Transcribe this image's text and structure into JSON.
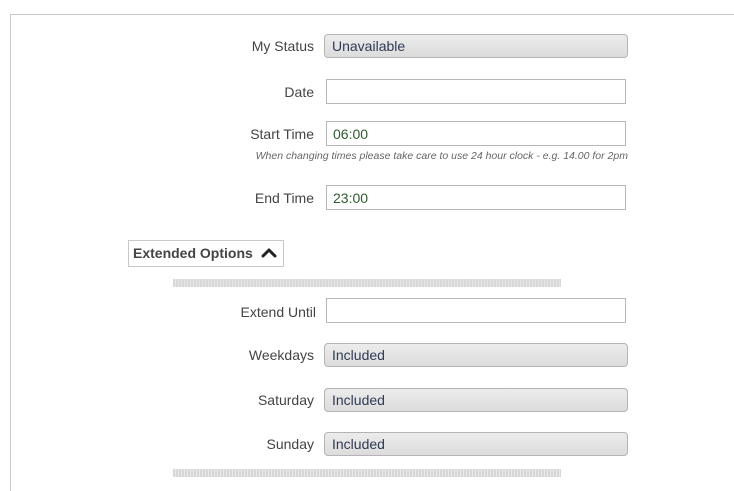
{
  "form": {
    "my_status": {
      "label": "My Status",
      "value": "Unavailable"
    },
    "date": {
      "label": "Date",
      "value": ""
    },
    "start_time": {
      "label": "Start Time",
      "value": "06:00"
    },
    "time_hint": "When changing times please take care to use 24 hour clock - e.g. 14.00 for 2pm",
    "end_time": {
      "label": "End Time",
      "value": "23:00"
    }
  },
  "extended": {
    "toggle_label": "Extended Options",
    "extend_until": {
      "label": "Extend Until",
      "value": ""
    },
    "weekdays": {
      "label": "Weekdays",
      "value": "Included"
    },
    "saturday": {
      "label": "Saturday",
      "value": "Included"
    },
    "sunday": {
      "label": "Sunday",
      "value": "Included"
    }
  },
  "icons": {
    "toggle": "chevron-up-icon"
  }
}
